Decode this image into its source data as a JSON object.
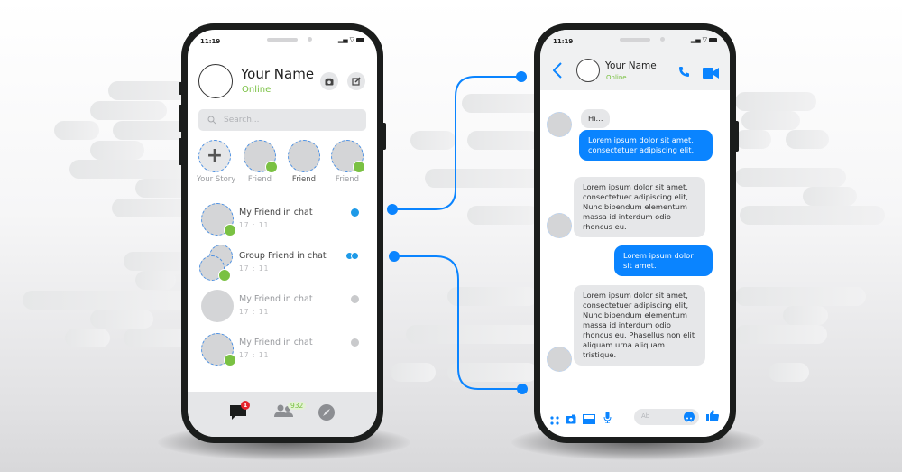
{
  "colors": {
    "accent": "#0a84ff",
    "online_green": "#7ac143",
    "badge_red": "#e5232c",
    "phone_frame": "#1b1d1c"
  },
  "left_phone": {
    "status_bar": {
      "time": "11:19"
    },
    "profile": {
      "name": "Your Name",
      "status": "Online"
    },
    "header_icons": [
      "camera-icon",
      "compose-icon"
    ],
    "search": {
      "placeholder": "Search..."
    },
    "stories": [
      {
        "label": "Your Story",
        "type": "add",
        "online": false
      },
      {
        "label": "Friend",
        "type": "friend",
        "online": true
      },
      {
        "label": "Friend",
        "type": "friend",
        "online": false
      },
      {
        "label": "Friend",
        "type": "friend",
        "online": true
      }
    ],
    "chats": [
      {
        "name": "My Friend in chat",
        "time": "17 : 11",
        "unread": "blue",
        "online": true,
        "group": false
      },
      {
        "name": "Group Friend in chat",
        "time": "17 : 11",
        "unread": "blue-double",
        "online": true,
        "group": true
      },
      {
        "name": "My Friend in chat",
        "time": "17 : 11",
        "unread": "grey",
        "online": false,
        "group": false
      },
      {
        "name": "My Friend in chat",
        "time": "17 : 11",
        "unread": "grey",
        "online": true,
        "group": false
      }
    ],
    "tabbar": {
      "chats_badge": "1",
      "people_badge": "932",
      "icons": [
        "chat-bubble-icon",
        "people-icon",
        "compass-icon"
      ]
    }
  },
  "right_phone": {
    "status_bar": {
      "time": "11:19"
    },
    "contact": {
      "name": "Your Name",
      "status": "Online"
    },
    "header_icons": [
      "back-icon",
      "phone-icon",
      "video-icon"
    ],
    "messages": [
      {
        "direction": "in",
        "text": "Hi..."
      },
      {
        "direction": "out",
        "text": "Lorem ipsum dolor sit amet, consectetuer adipiscing elit."
      },
      {
        "direction": "in",
        "text": "Lorem ipsum dolor sit amet, consectetuer adipiscing elit, Nunc bibendum elementum massa id interdum odio rhoncus eu."
      },
      {
        "direction": "out",
        "text": "Lorem ipsum dolor sit amet."
      },
      {
        "direction": "in",
        "text": "Lorem ipsum dolor sit amet, consectetuer adipiscing elit, Nunc bibendum elementum massa id interdum odio rhoncus eu. Phasellus non elit aliquam urna aliquam tristique."
      }
    ],
    "composer": {
      "placeholder": "Ab",
      "icons": [
        "apps-grid-icon",
        "camera-icon",
        "image-icon",
        "microphone-icon",
        "emoji-icon",
        "thumbs-up-icon"
      ]
    }
  }
}
